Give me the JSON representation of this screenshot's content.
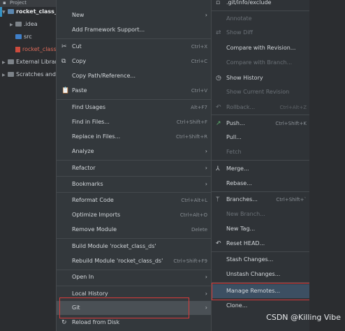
{
  "tree": {
    "header": "Project",
    "root": "rocket_class_d",
    "items": [
      {
        "label": ".idea"
      },
      {
        "label": "src"
      },
      {
        "label": "rocket_class"
      },
      {
        "label": "External Librar"
      },
      {
        "label": "Scratches and"
      }
    ]
  },
  "menu": {
    "items": [
      {
        "label": "New"
      },
      {
        "label": "Add Framework Support..."
      },
      {
        "label": "Cut",
        "shortcut": "Ctrl+X"
      },
      {
        "label": "Copy",
        "shortcut": "Ctrl+C"
      },
      {
        "label": "Copy Path/Reference..."
      },
      {
        "label": "Paste",
        "shortcut": "Ctrl+V"
      },
      {
        "label": "Find Usages",
        "shortcut": "Alt+F7"
      },
      {
        "label": "Find in Files...",
        "shortcut": "Ctrl+Shift+F"
      },
      {
        "label": "Replace in Files...",
        "shortcut": "Ctrl+Shift+R"
      },
      {
        "label": "Analyze"
      },
      {
        "label": "Refactor"
      },
      {
        "label": "Bookmarks"
      },
      {
        "label": "Reformat Code",
        "shortcut": "Ctrl+Alt+L"
      },
      {
        "label": "Optimize Imports",
        "shortcut": "Ctrl+Alt+O"
      },
      {
        "label": "Remove Module",
        "shortcut": "Delete"
      },
      {
        "label": "Build Module 'rocket_class_ds'"
      },
      {
        "label": "Rebuild Module 'rocket_class_ds'",
        "shortcut": "Ctrl+Shift+F9"
      },
      {
        "label": "Open In"
      },
      {
        "label": "Local History"
      },
      {
        "label": "Git"
      },
      {
        "label": "Reload from Disk"
      }
    ]
  },
  "submenu": {
    "items": [
      {
        "label": ".git/info/exclude"
      },
      {
        "label": "Annotate"
      },
      {
        "label": "Show Diff"
      },
      {
        "label": "Compare with Revision..."
      },
      {
        "label": "Compare with Branch..."
      },
      {
        "label": "Show History"
      },
      {
        "label": "Show Current Revision"
      },
      {
        "label": "Rollback...",
        "shortcut": "Ctrl+Alt+Z"
      },
      {
        "label": "Push...",
        "shortcut": "Ctrl+Shift+K"
      },
      {
        "label": "Pull..."
      },
      {
        "label": "Fetch"
      },
      {
        "label": "Merge..."
      },
      {
        "label": "Rebase..."
      },
      {
        "label": "Branches...",
        "shortcut": "Ctrl+Shift+`"
      },
      {
        "label": "New Branch..."
      },
      {
        "label": "New Tag..."
      },
      {
        "label": "Reset HEAD..."
      },
      {
        "label": "Stash Changes..."
      },
      {
        "label": "Unstash Changes..."
      },
      {
        "label": "Manage Remotes..."
      },
      {
        "label": "Clone..."
      }
    ]
  },
  "watermark": "CSDN @Killing Vibe"
}
